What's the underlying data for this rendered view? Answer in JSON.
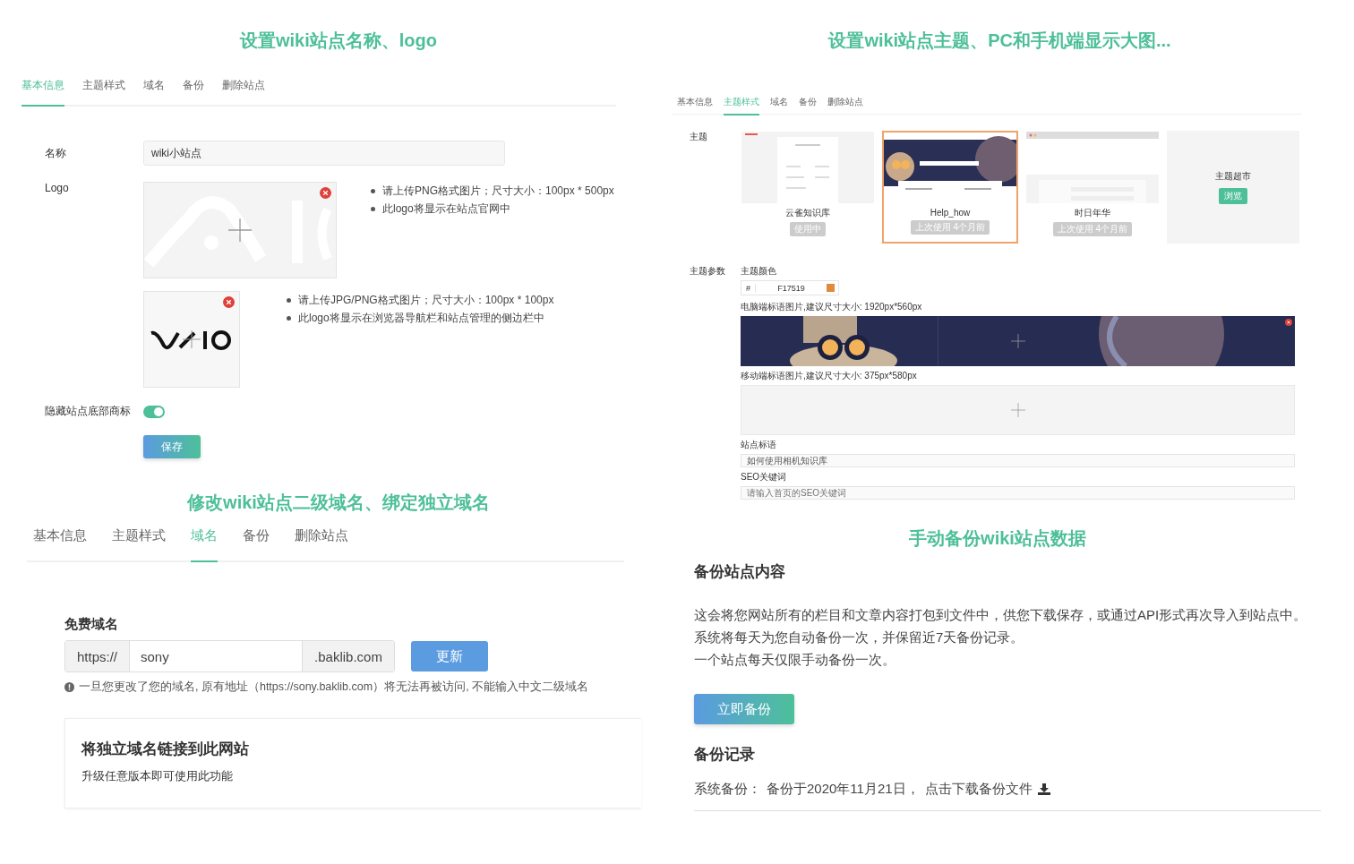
{
  "basic_info": {
    "title": "设置wiki站点名称、logo",
    "tabs": [
      {
        "label": "基本信息",
        "selected": true
      },
      {
        "label": "主题样式",
        "selected": false
      },
      {
        "label": "域名",
        "selected": false
      },
      {
        "label": "备份",
        "selected": false
      },
      {
        "label": "删除站点",
        "selected": false
      }
    ],
    "name_label": "名称",
    "name_value": "wiki小站点",
    "logo_label": "Logo",
    "logo_large_hints": [
      "请上传PNG格式图片；尺寸大小：100px * 500px",
      "此logo将显示在站点官网中"
    ],
    "logo_small_hints": [
      "请上传JPG/PNG格式图片；尺寸大小：100px * 100px",
      "此logo将显示在浏览器导航栏和站点管理的侧边栏中"
    ],
    "hide_footer_label": "隐藏站点底部商标",
    "hide_footer_on": true,
    "save_button": "保存"
  },
  "theme_style": {
    "title": "设置wiki站点主题、PC和手机端显示大图...",
    "tabs": [
      {
        "label": "基本信息",
        "selected": false
      },
      {
        "label": "主题样式",
        "selected": true
      },
      {
        "label": "域名",
        "selected": false
      },
      {
        "label": "备份",
        "selected": false
      },
      {
        "label": "删除站点",
        "selected": false
      }
    ],
    "theme_label": "主题",
    "themes": [
      {
        "kind": "light",
        "name": "云雀知识库",
        "badge": "使用中",
        "selected": false
      },
      {
        "kind": "dark",
        "name": "Help_how",
        "badge": "上次使用 4个月前",
        "selected": true
      },
      {
        "kind": "browser",
        "name": "时日年华",
        "badge": "上次使用 4个月前",
        "selected": false
      }
    ],
    "store": {
      "name": "主题超市",
      "button": "浏览"
    },
    "params_label": "主题参数",
    "color_label": "主题颜色",
    "color_prefix": "#",
    "color_value": "F17519",
    "color": "#e08a3c",
    "pc_banner_label": "电脑端标语图片,建议尺寸大小: 1920px*560px",
    "mobile_banner_label": "移动端标语图片,建议尺寸大小: 375px*580px",
    "tagline_label": "站点标语",
    "tagline_value": "如何使用相机知识库",
    "seo_label": "SEO关键词",
    "seo_placeholder": "请输入首页的SEO关键词"
  },
  "domain": {
    "title": "修改wiki站点二级域名、绑定独立域名",
    "tabs": [
      {
        "label": "基本信息",
        "selected": false
      },
      {
        "label": "主题样式",
        "selected": false
      },
      {
        "label": "域名",
        "selected": true
      },
      {
        "label": "备份",
        "selected": false
      },
      {
        "label": "删除站点",
        "selected": false
      }
    ],
    "free_label": "免费域名",
    "prefix": "https://",
    "value": "sony",
    "suffix": ".baklib.com",
    "button": "更新",
    "note": "一旦您更改了您的域名, 原有地址（https://sony.baklib.com）将无法再被访问, 不能输入中文二级域名",
    "custom_title": "将独立域名链接到此网站",
    "custom_desc": "升级任意版本即可使用此功能"
  },
  "backup": {
    "title": "手动备份wiki站点数据",
    "heading": "备份站点内容",
    "paragraphs": [
      "这会将您网站所有的栏目和文章内容打包到文件中，供您下载保存，或通过API形式再次导入到站点中。",
      "系统将每天为您自动备份一次，并保留近7天备份记录。",
      "一个站点每天仅限手动备份一次。"
    ],
    "button": "立即备份",
    "records_heading": "备份记录",
    "record_label": "系统备份：",
    "record_date": "备份于2020年11月21日，",
    "record_link": "点击下载备份文件"
  }
}
